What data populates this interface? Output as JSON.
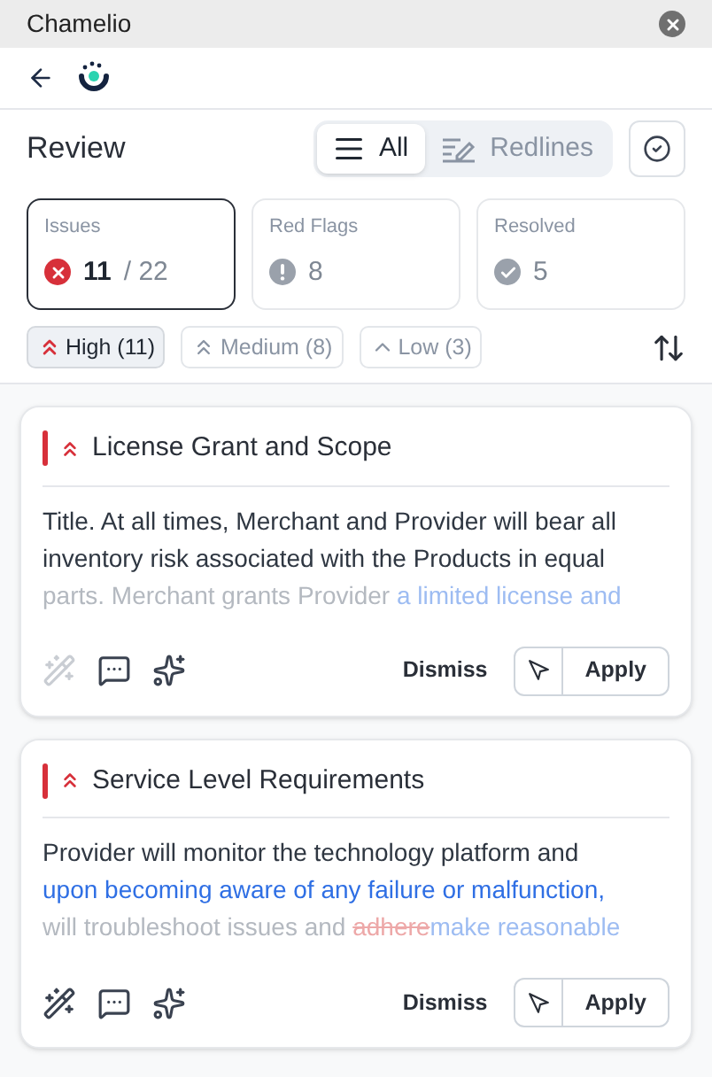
{
  "window": {
    "title": "Chamelio"
  },
  "header": {
    "title": "Review"
  },
  "view_tabs": [
    {
      "label": "All",
      "kind": "list",
      "selected": true
    },
    {
      "label": "Redlines",
      "kind": "redline",
      "selected": false
    }
  ],
  "stats": [
    {
      "label": "Issues",
      "kind": "issues",
      "value": "11",
      "total": "/ 22",
      "selected": true
    },
    {
      "label": "Red Flags",
      "kind": "flags",
      "value": "8",
      "selected": false
    },
    {
      "label": "Resolved",
      "kind": "resolved",
      "value": "5",
      "selected": false
    }
  ],
  "filters": [
    {
      "label": "High (11)",
      "kind": "high",
      "selected": true
    },
    {
      "label": "Medium (8)",
      "kind": "medium",
      "selected": false
    },
    {
      "label": "Low (3)",
      "kind": "low",
      "selected": false
    }
  ],
  "cards": [
    {
      "title": "License Grant and Scope",
      "rewrite_enabled": false,
      "lines": [
        [
          {
            "text": "Title. At all times, Merchant and Provider will bear all",
            "kind": "plain"
          }
        ],
        [
          {
            "text": "inventory risk associated with the Products in equal",
            "kind": "plain"
          }
        ],
        [
          {
            "text": "parts. Merchant grants Provider ",
            "kind": "faded"
          },
          {
            "text": "a limited license and",
            "kind": "faded-insert"
          }
        ]
      ],
      "dismiss": "Dismiss",
      "apply": "Apply"
    },
    {
      "title": "Service Level Requirements",
      "rewrite_enabled": true,
      "lines": [
        [
          {
            "text": "Provider will monitor the technology platform and",
            "kind": "plain"
          }
        ],
        [
          {
            "text": "upon becoming aware of any failure or malfunction,",
            "kind": "insert"
          }
        ],
        [
          {
            "text": "will troubleshoot issues and ",
            "kind": "faded"
          },
          {
            "text": "adhere",
            "kind": "faded-delete"
          },
          {
            "text": "make reasonable",
            "kind": "faded-insert"
          }
        ]
      ],
      "dismiss": "Dismiss",
      "apply": "Apply"
    }
  ]
}
